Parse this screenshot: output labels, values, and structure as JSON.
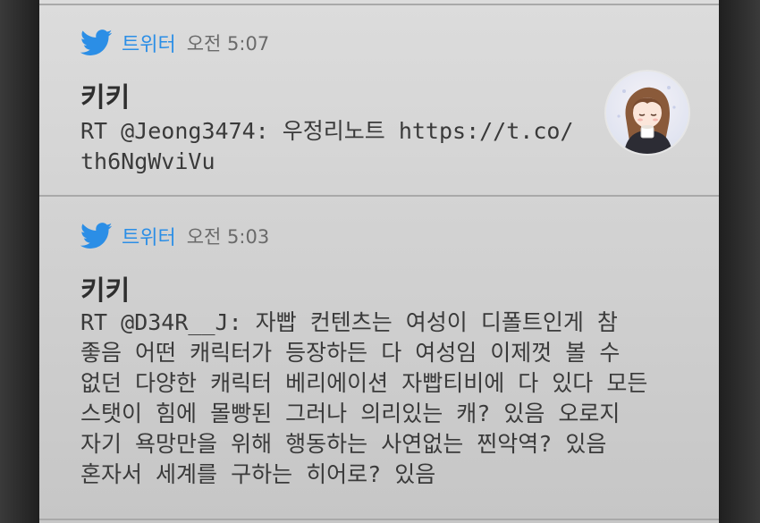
{
  "notifications": [
    {
      "source": "트위터",
      "time": "오전 5:07",
      "author": "키키",
      "text": "RT @Jeong3474: 우정리노트 https://t.co/\nth6NgWviVu",
      "has_avatar": true,
      "icon": "twitter-bird-icon"
    },
    {
      "source": "트위터",
      "time": "오전 5:03",
      "author": "키키",
      "text": "RT @D34R__J: 자빱 컨텐츠는 여성이 디폴트인게 참\n좋음 어떤 캐릭터가 등장하든 다 여성임 이제껏 볼 수\n없던 다양한 캐릭터 베리에이션 자빱티비에 다 있다 모든\n스탯이 힘에 몰빵된 그러나 의리있는 캐? 있음 오로지\n자기 욕망만을 위해 행동하는 사연없는 찐악역? 있음\n혼자서 세계를 구하는 히어로? 있음",
      "has_avatar": false,
      "icon": "twitter-bird-icon"
    }
  ],
  "colors": {
    "twitter_blue": "#2b8ee6",
    "panel_bg": "#d4d4d4",
    "frame": "#2b2b2b"
  }
}
